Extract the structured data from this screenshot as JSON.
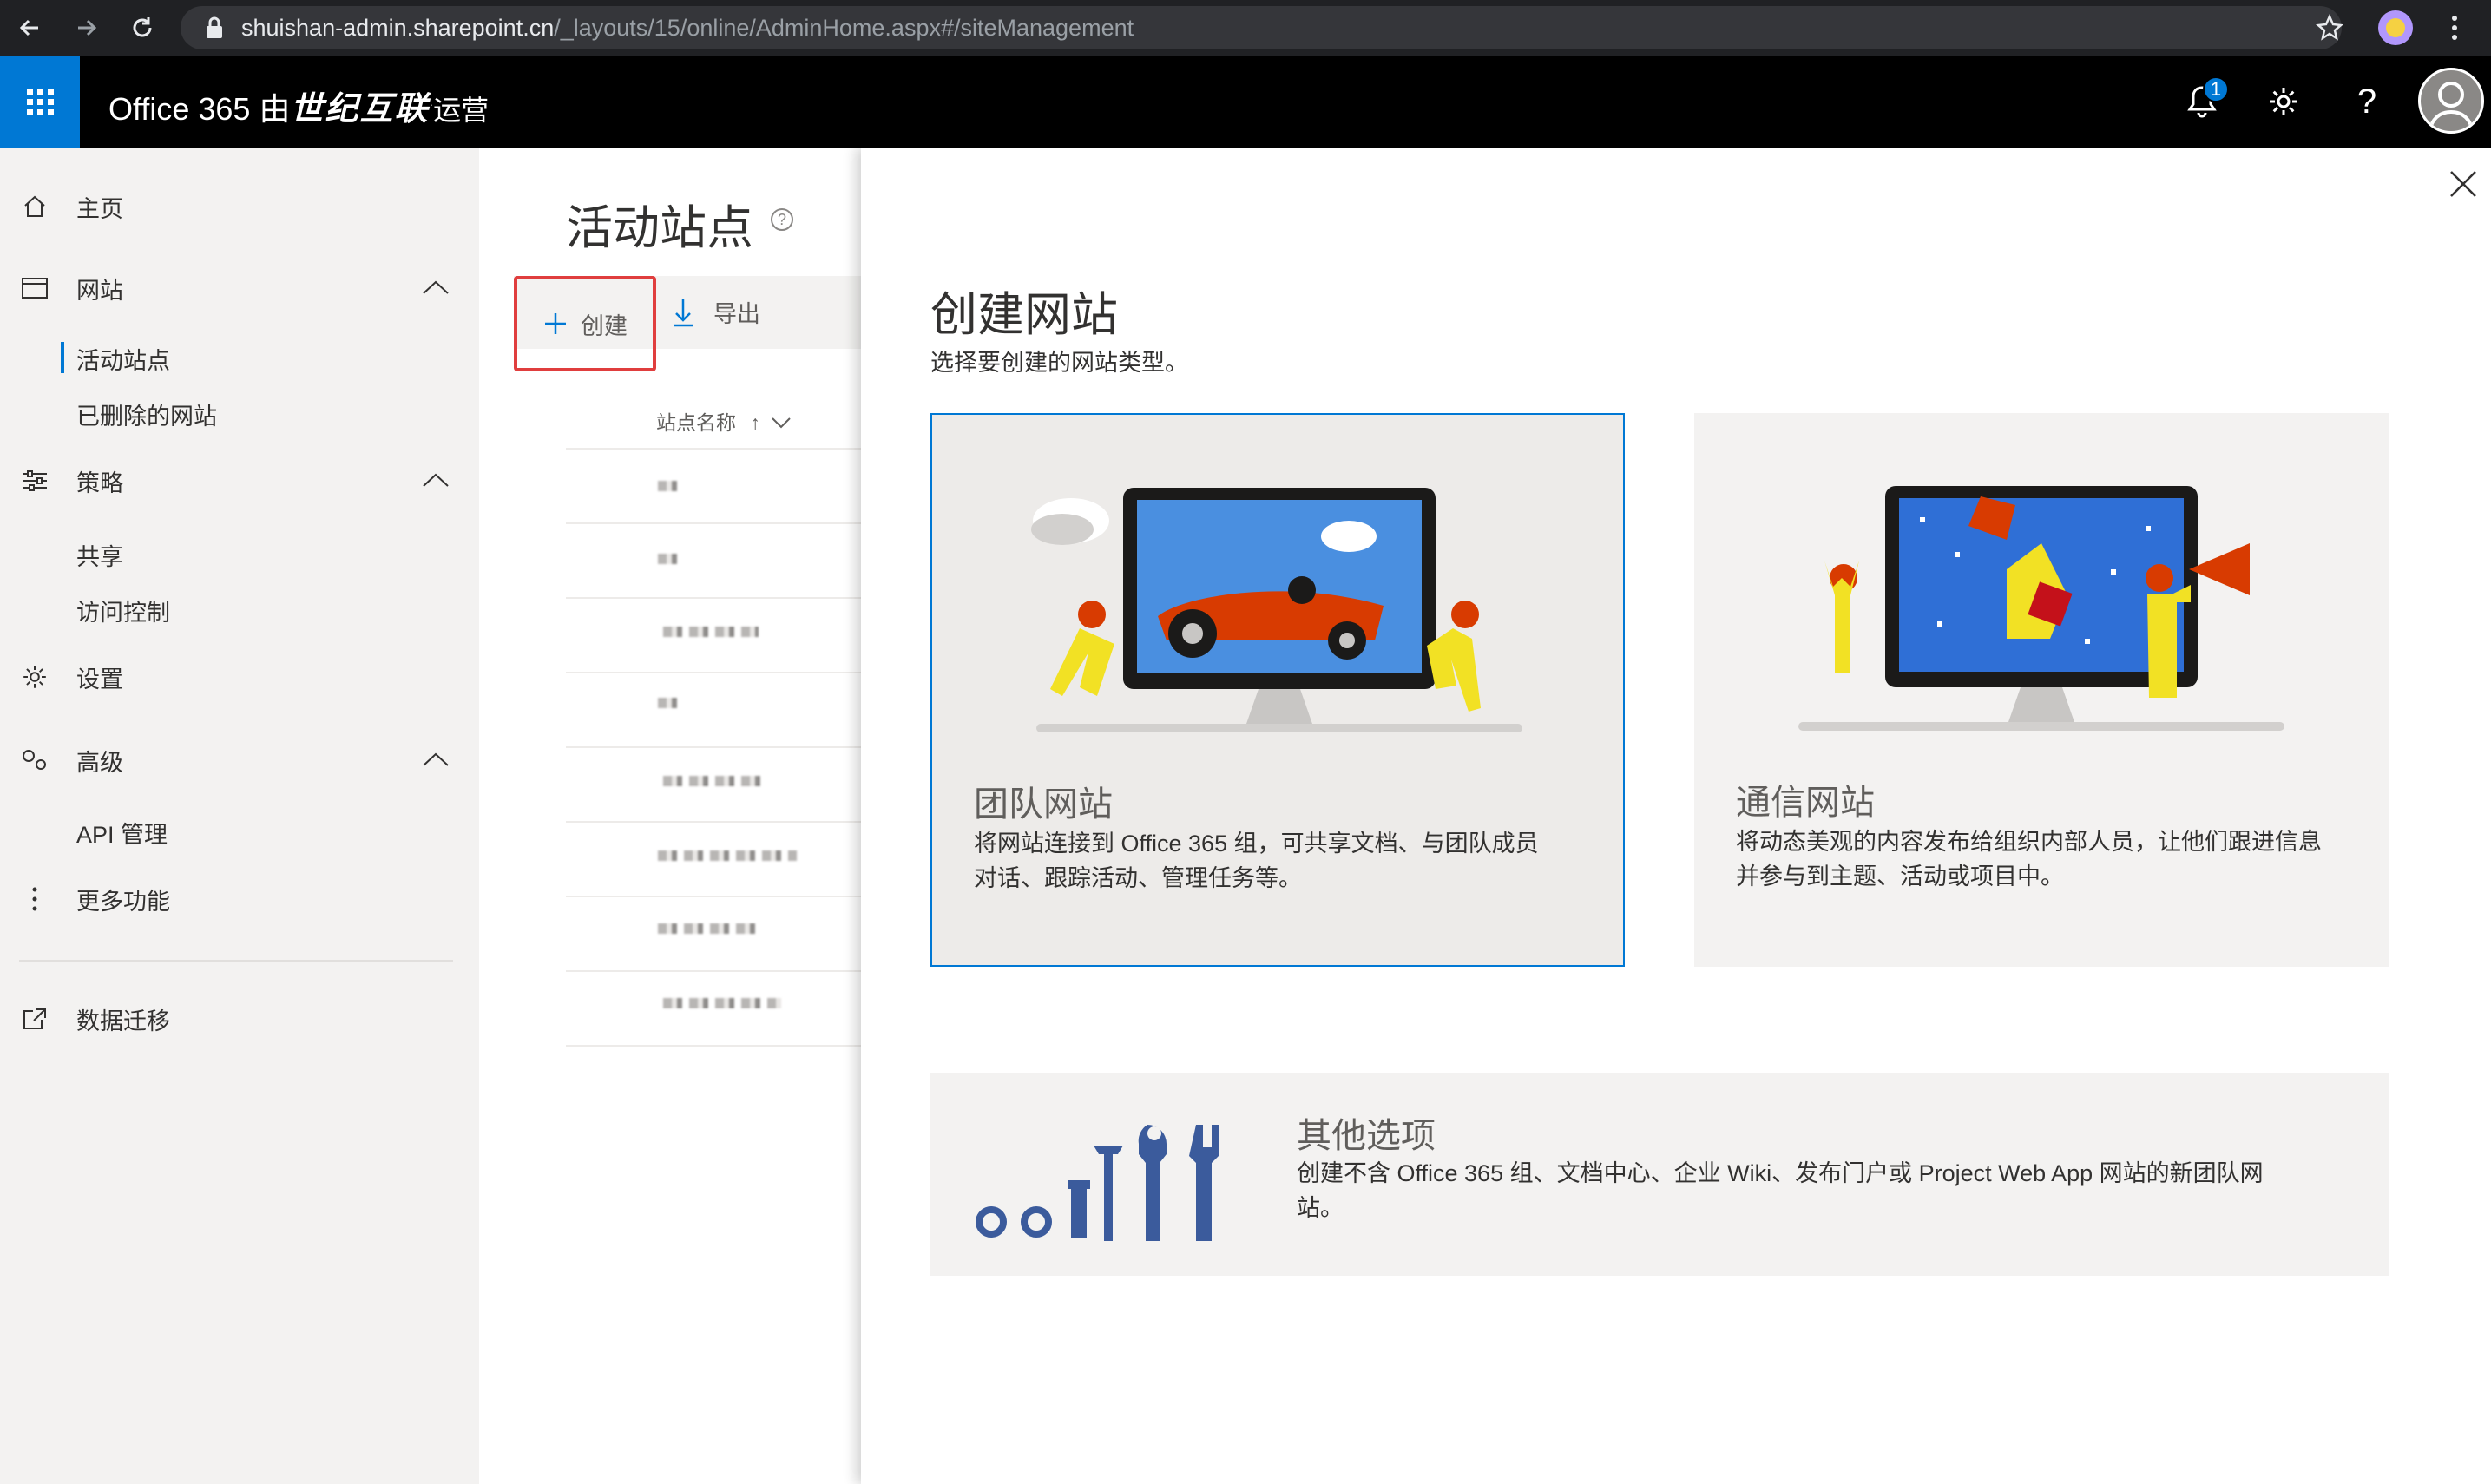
{
  "browser": {
    "url_host": "shuishan-admin.sharepoint.cn",
    "url_path": "/_layouts/15/online/AdminHome.aspx#/siteManagement"
  },
  "header": {
    "brand_prefix": "Office 365",
    "brand_by": "由",
    "brand_name": "世纪互联",
    "brand_suffix": "运营",
    "notification_count": "1",
    "help_label": "?"
  },
  "leftnav": {
    "items": [
      {
        "label": "主页",
        "icon": "home-icon"
      },
      {
        "label": "网站",
        "icon": "site-icon"
      },
      {
        "label": "策略",
        "icon": "policy-icon"
      },
      {
        "label": "设置",
        "icon": "gear-icon"
      },
      {
        "label": "高级",
        "icon": "advanced-icon"
      },
      {
        "label": "更多功能",
        "icon": "more-icon"
      },
      {
        "label": "数据迁移",
        "icon": "migration-icon"
      }
    ],
    "sites_sub": [
      "活动站点",
      "已删除的网站"
    ],
    "policy_sub": [
      "共享",
      "访问控制"
    ],
    "advanced_sub": [
      "API 管理"
    ]
  },
  "main": {
    "title": "活动站点",
    "create_label": "创建",
    "export_label": "导出",
    "column_site_name": "站点名称"
  },
  "panel": {
    "title": "创建网站",
    "subtitle": "选择要创建的网站类型。",
    "cards": [
      {
        "title": "团队网站",
        "desc_line1": "将网站连接到 Office 365 组，可共享文档、与团队成员",
        "desc_line2": "对话、跟踪活动、管理任务等。"
      },
      {
        "title": "通信网站",
        "desc_line1": "将动态美观的内容发布给组织内部人员，让他们跟进信息",
        "desc_line2": "并参与到主题、活动或项目中。"
      }
    ],
    "other": {
      "title": "其他选项",
      "desc_line1": "创建不含 Office 365 组、文档中心、企业 Wiki、发布门户或 Project Web App 网站的新团队网",
      "desc_line2": "站。"
    }
  },
  "colors": {
    "accent": "#0078d4",
    "highlight_border": "#e03e3e",
    "nav_bg": "#f3f2f1"
  }
}
